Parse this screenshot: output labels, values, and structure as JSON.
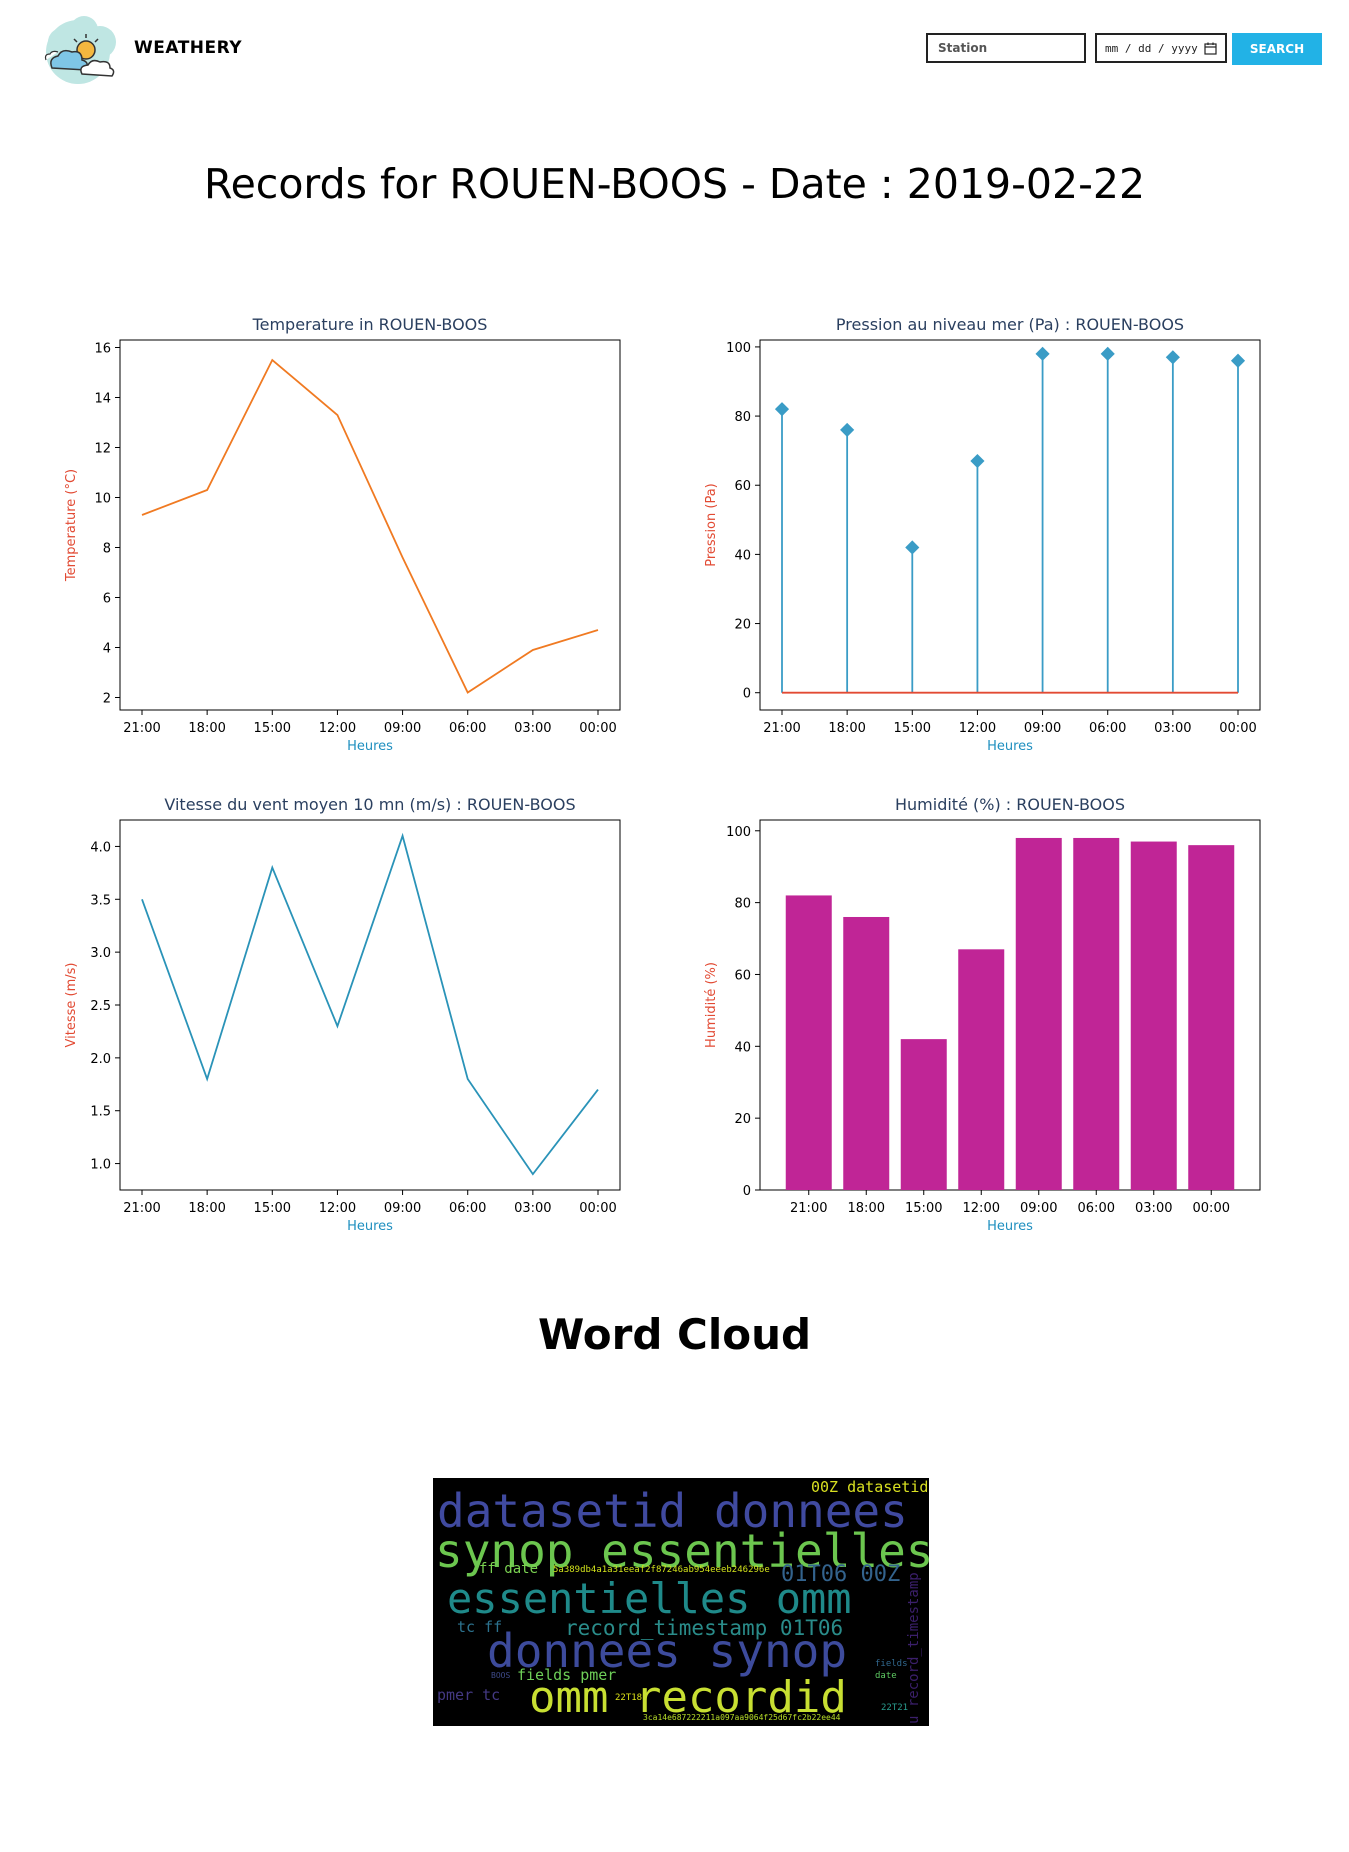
{
  "header": {
    "brand": "WEATHERY",
    "station_placeholder": "Station",
    "date_placeholder": "mm / dd / yyyy",
    "search_label": "SEARCH"
  },
  "page_title": "Records for ROUEN-BOOS - Date : 2019-02-22",
  "colors": {
    "accent": "#22b2e6",
    "title_color": "#2a3f5f",
    "ylabel_color": "#e24a33",
    "xlabel_color": "#1f8fbf"
  },
  "chart_data": [
    {
      "type": "line",
      "title": "Temperature in ROUEN-BOOS",
      "xlabel": "Heures",
      "ylabel": "Temperature (°C)",
      "categories": [
        "21:00",
        "18:00",
        "15:00",
        "12:00",
        "09:00",
        "06:00",
        "03:00",
        "00:00"
      ],
      "values": [
        9.3,
        10.3,
        15.5,
        13.3,
        7.6,
        2.2,
        3.9,
        4.7
      ],
      "ylim": [
        1.5,
        16.3
      ],
      "yticks": [
        2,
        4,
        6,
        8,
        10,
        12,
        14,
        16
      ],
      "color": "#f07a22"
    },
    {
      "type": "stem",
      "title": "Pression au niveau mer (Pa) : ROUEN-BOOS",
      "xlabel": "Heures",
      "ylabel": "Pression (Pa)",
      "categories": [
        "21:00",
        "18:00",
        "15:00",
        "12:00",
        "09:00",
        "06:00",
        "03:00",
        "00:00"
      ],
      "values": [
        82,
        76,
        42,
        67,
        98,
        98,
        97,
        96
      ],
      "ylim": [
        -5,
        102
      ],
      "yticks": [
        0,
        20,
        40,
        60,
        80,
        100
      ],
      "color": "#3a9cc6",
      "baseline_color": "#e24a33"
    },
    {
      "type": "line",
      "title": "Vitesse du vent moyen 10 mn (m/s) : ROUEN-BOOS",
      "xlabel": "Heures",
      "ylabel": "Vitesse (m/s)",
      "categories": [
        "21:00",
        "18:00",
        "15:00",
        "12:00",
        "09:00",
        "06:00",
        "03:00",
        "00:00"
      ],
      "values": [
        3.5,
        1.8,
        3.8,
        2.3,
        4.1,
        1.8,
        0.9,
        1.7
      ],
      "ylim": [
        0.75,
        4.25
      ],
      "yticks": [
        1.0,
        1.5,
        2.0,
        2.5,
        3.0,
        3.5,
        4.0
      ],
      "color": "#2a93b8"
    },
    {
      "type": "bar",
      "title": "Humidité (%) : ROUEN-BOOS",
      "xlabel": "Heures",
      "ylabel": "Humidité (%)",
      "categories": [
        "21:00",
        "18:00",
        "15:00",
        "12:00",
        "09:00",
        "06:00",
        "03:00",
        "00:00"
      ],
      "values": [
        82,
        76,
        42,
        67,
        98,
        98,
        97,
        96
      ],
      "ylim": [
        0,
        103
      ],
      "yticks": [
        0,
        20,
        40,
        60,
        80,
        100
      ],
      "color": "#c02596"
    }
  ],
  "wordcloud": {
    "title": "Word Cloud",
    "words": [
      {
        "text": "datasetid donnees",
        "color": "#404aa0",
        "size": 46
      },
      {
        "text": "synop essentielles",
        "color": "#6cc64f",
        "size": 46
      },
      {
        "text": "essentielles omm",
        "color": "#1f8a8a",
        "size": 42
      },
      {
        "text": "donnees synop",
        "color": "#3d4b9c",
        "size": 46
      },
      {
        "text": "omm recordid",
        "color": "#c8df32",
        "size": 44
      },
      {
        "text": "01T06 00Z",
        "color": "#33638d",
        "size": 22
      },
      {
        "text": "record_timestamp 01T06",
        "color": "#2a8c8a",
        "size": 21
      },
      {
        "text": "00Z datasetid",
        "color": "#d9e021",
        "size": 15
      },
      {
        "text": "ff date",
        "color": "#7ad151",
        "size": 14
      },
      {
        "text": "fields pmer",
        "color": "#6ece58",
        "size": 15
      },
      {
        "text": "pmer tc",
        "color": "#443983",
        "size": 15
      },
      {
        "text": "tc ff",
        "color": "#2c728e",
        "size": 15
      },
      {
        "text": "u record_timestamp",
        "color": "#3b1f6b",
        "size": 14
      },
      {
        "text": "5a389db4a1a31eeaf2f87246ab954eeeb246296e",
        "color": "#d2e21b",
        "size": 9
      },
      {
        "text": "3ca14e687222211a097aa9064f25d67fc2b22ee44",
        "color": "#b8de29",
        "size": 8
      },
      {
        "text": "22T18",
        "color": "#dde318",
        "size": 9
      },
      {
        "text": "22T21",
        "color": "#2a9d8f",
        "size": 9
      },
      {
        "text": "fields",
        "color": "#31688e",
        "size": 9
      },
      {
        "text": "date",
        "color": "#5ec962",
        "size": 9
      },
      {
        "text": "BOOS",
        "color": "#3e4a89",
        "size": 8
      }
    ]
  }
}
